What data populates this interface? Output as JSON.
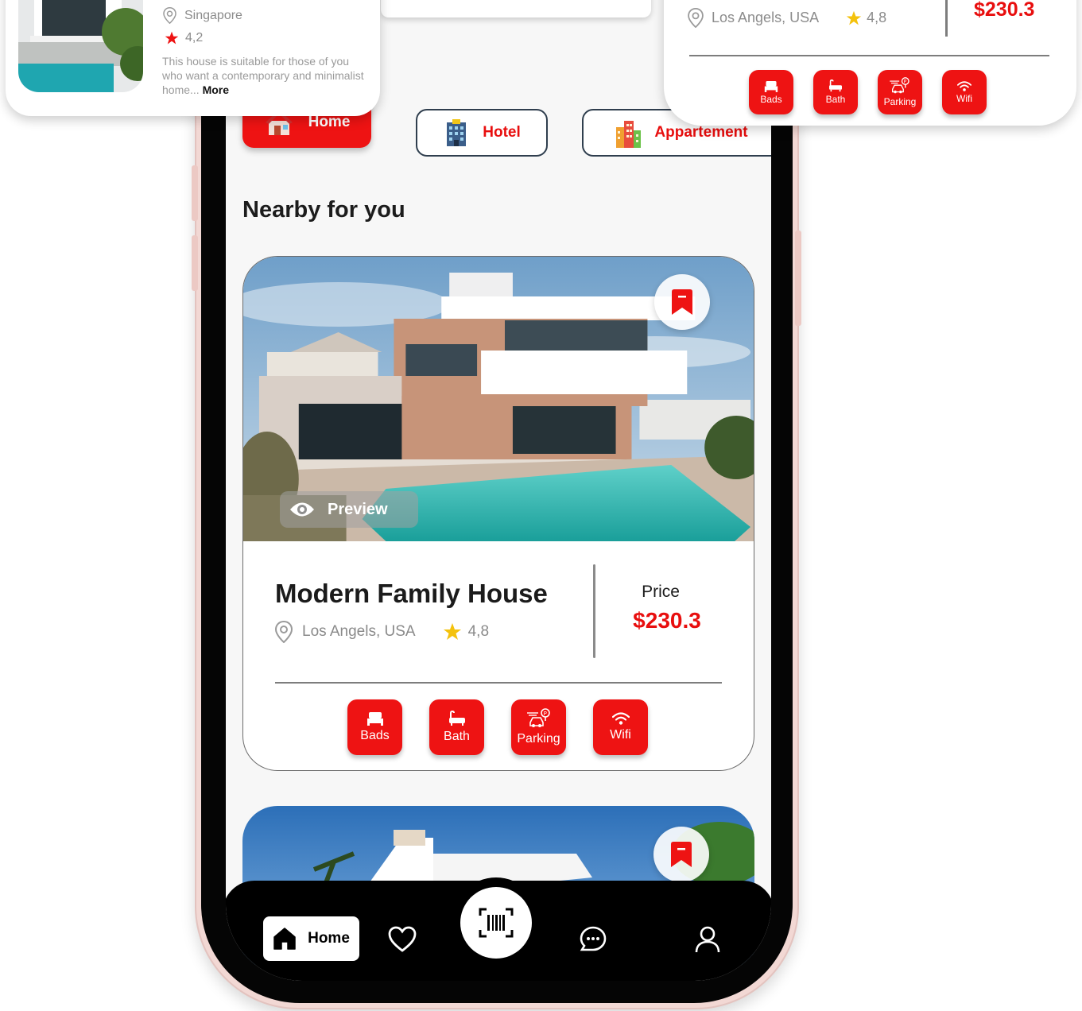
{
  "colors": {
    "accent": "#ee1313",
    "dark": "#000000",
    "text_muted": "#8a8a8a",
    "star": "#f4c20d"
  },
  "top_left_card": {
    "location": "Singapore",
    "rating": "4,2",
    "description": "This house is suitable for those of you who want a contemporary and minimalist home...",
    "more_label": "More"
  },
  "top_right_card": {
    "location": "Los Angels, USA",
    "rating": "4,8",
    "price": "$230.3",
    "amenities": [
      "Bads",
      "Bath",
      "Parking",
      "Wifi"
    ]
  },
  "categories": [
    {
      "label": "Home",
      "icon": "house-icon",
      "active": true
    },
    {
      "label": "Hotel",
      "icon": "hotel-building-icon",
      "active": false
    },
    {
      "label": "Appartement",
      "icon": "apartment-building-icon",
      "active": false
    }
  ],
  "section_title": "Nearby for you",
  "listing": {
    "preview_label": "Preview",
    "title": "Modern Family House",
    "location": "Los Angels, USA",
    "rating": "4,8",
    "price_label": "Price",
    "price": "$230.3",
    "amenities": [
      "Bads",
      "Bath",
      "Parking",
      "Wifi"
    ]
  },
  "bottom_nav": {
    "home_label": "Home",
    "items": [
      "home-icon",
      "heart-icon",
      "barcode-scan-icon",
      "chat-icon",
      "profile-icon"
    ]
  }
}
